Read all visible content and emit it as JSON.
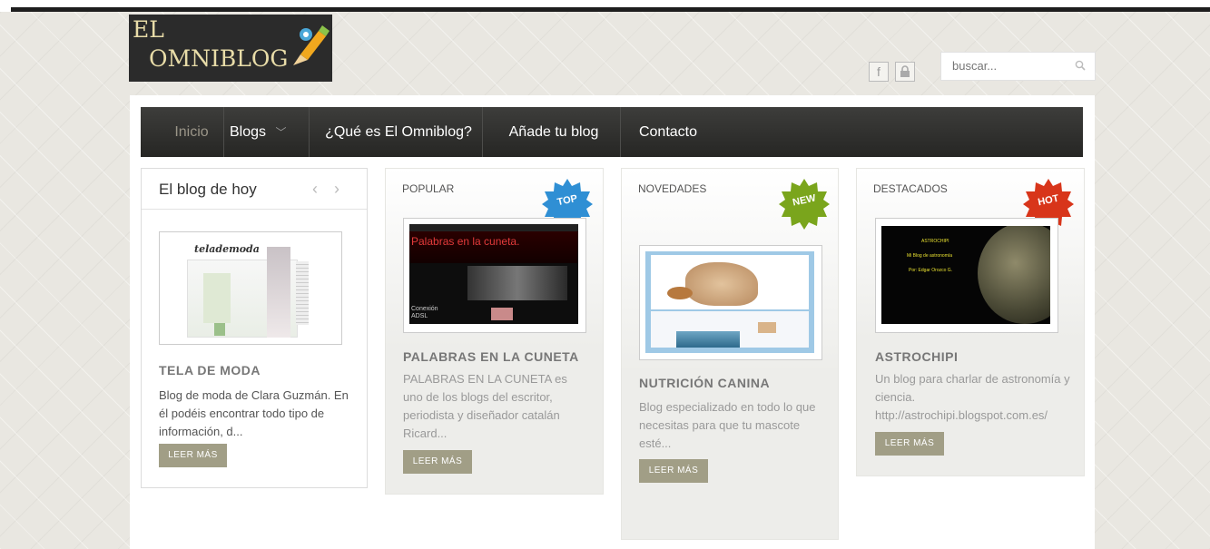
{
  "site": {
    "logo_line1": "EL",
    "logo_line2": "OMNIBLOG"
  },
  "header": {
    "search_placeholder": "buscar...",
    "social": [
      {
        "icon": "facebook-icon",
        "glyph": "f"
      },
      {
        "icon": "lock-icon",
        "glyph": "🔒"
      }
    ]
  },
  "nav": {
    "items": [
      {
        "label": "Inicio",
        "active": true
      },
      {
        "label": "Blogs",
        "dropdown": true
      },
      {
        "label": "¿Qué es El Omniblog?"
      },
      {
        "label": "Añade tu blog"
      },
      {
        "label": "Contacto"
      }
    ],
    "dropdown_glyph": "﹀"
  },
  "today": {
    "heading": "El blog de hoy",
    "prev_glyph": "‹",
    "next_glyph": "›",
    "thumb_text": "telademoda",
    "title": "TELA DE MODA",
    "desc": "Blog de moda de Clara Guzmán. En él podéis encontrar todo tipo de información, d...",
    "button": "LEER MÁS"
  },
  "popular": {
    "tag": "POPULAR",
    "badge": "TOP",
    "thumb_heading": "Palabras en la cuneta.",
    "thumb_caption": "Conexión ADSL",
    "title": "PALABRAS EN LA CUNETA",
    "desc": "PALABRAS EN LA CUNETA es uno de los blogs del escritor, periodista y diseñador catalán Ricard...",
    "button": "LEER MÁS"
  },
  "novedades": {
    "tag": "NOVEDADES",
    "badge": "NEW",
    "title": "NUTRICIÓN CANINA",
    "desc": "Blog especializado en todo lo que necesitas para que tu mascote esté...",
    "button": "LEER MÁS"
  },
  "destacados": {
    "tag": "DESTACADOS",
    "badge": "HOT",
    "thumb_line1": "ASTROCHIPI",
    "thumb_line2": "Mi Blog de astronomía",
    "thumb_line3": "Por: Edgar Orozco G.",
    "title": "ASTROCHIPI",
    "desc": "Un blog para charlar de astronomía y ciencia. http://astrochipi.blogspot.com.es/",
    "button": "LEER MÁS"
  },
  "colors": {
    "nav_bg": "#2f2f2d",
    "button": "#a19e86",
    "badge_top": "#2f8fd4",
    "badge_new": "#7aa51c",
    "badge_hot": "#d8351a"
  }
}
